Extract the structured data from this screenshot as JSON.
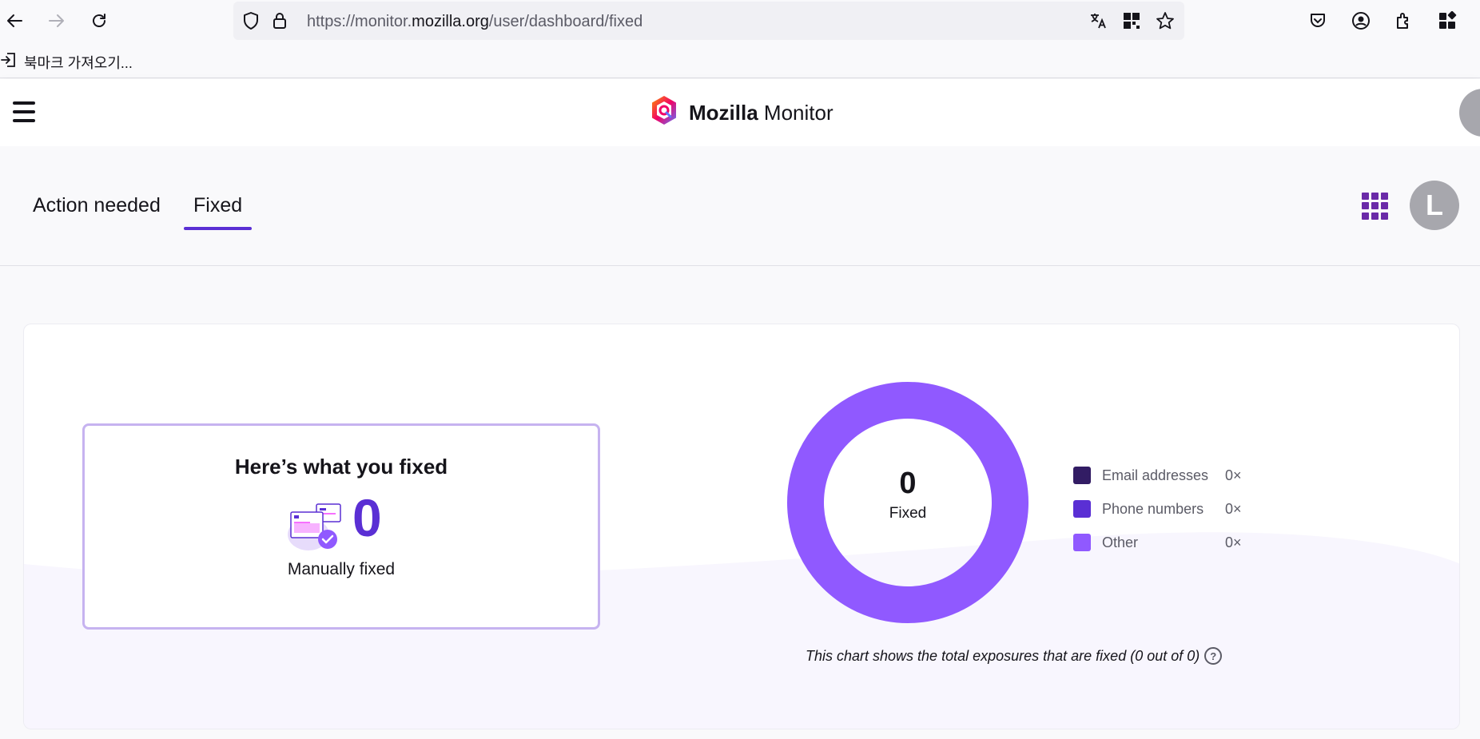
{
  "browser": {
    "url_prefix": "https://monitor.",
    "url_domain": "mozilla.org",
    "url_path": "/user/dashboard/fixed",
    "bookmark_label": "북마크 가져오기..."
  },
  "header": {
    "brand_bold": "Mozilla",
    "brand_light": "Monitor",
    "avatar_letter": "L"
  },
  "tabs": [
    {
      "label": "Action needed",
      "active": false
    },
    {
      "label": "Fixed",
      "active": true
    }
  ],
  "summary": {
    "title": "Here’s what you fixed",
    "count": "0",
    "subtitle": "Manually fixed"
  },
  "chart_data": {
    "type": "pie",
    "center_value": "0",
    "center_label": "Fixed",
    "categories": [
      "Email addresses",
      "Phone numbers",
      "Other"
    ],
    "values": [
      0,
      0,
      0
    ],
    "value_labels": [
      "0×",
      "0×",
      "0×"
    ],
    "colors": [
      "#321c64",
      "#5a2fd4",
      "#9059ff"
    ],
    "ring_color": "#9059ff",
    "caption": "This chart shows the total exposures that are fixed (0 out of 0)",
    "legend_position": "right"
  },
  "colors": {
    "accent": "#5a2fd4",
    "tab_indicator": "#5a2fd4",
    "box_border": "#c6b3f0",
    "apps_icon": "#6a2aa8",
    "avatar_bg": "#a7a7ad"
  }
}
